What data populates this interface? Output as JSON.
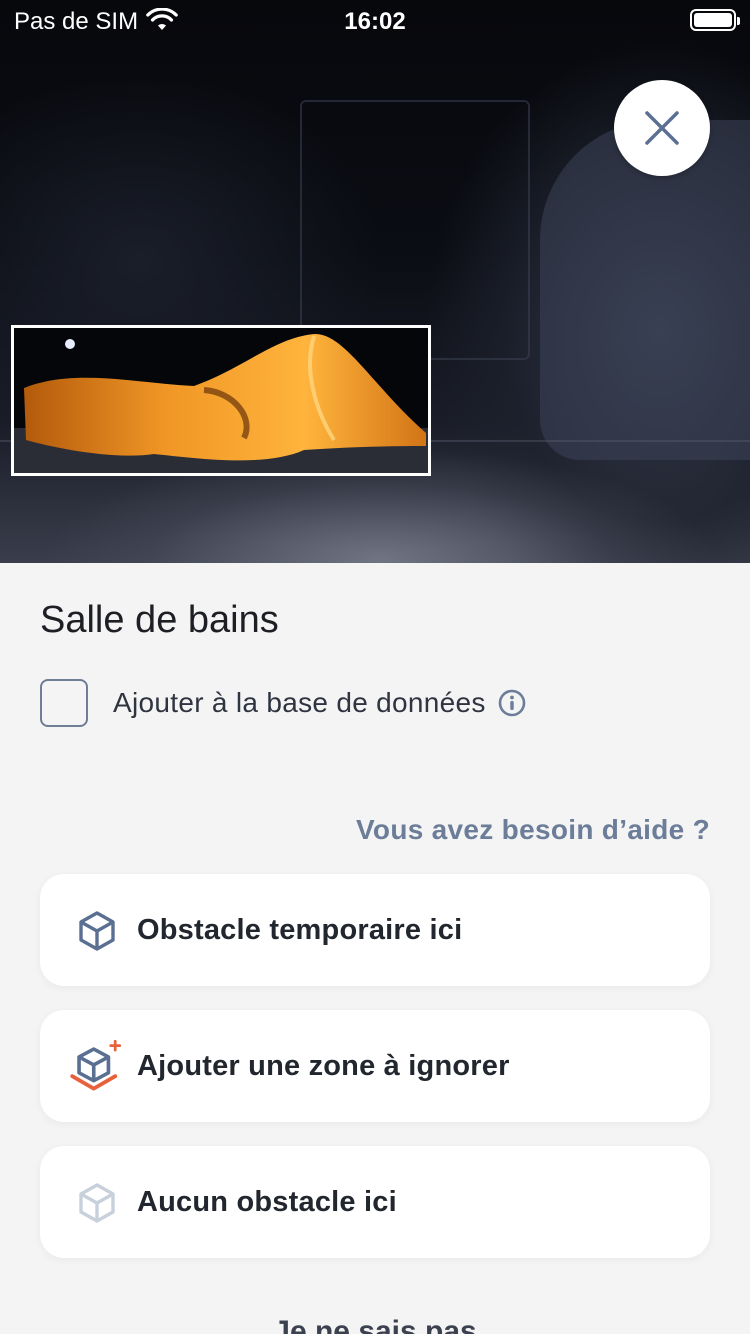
{
  "status_bar": {
    "carrier": "Pas de SIM",
    "time": "16:02"
  },
  "room": {
    "title": "Salle de bains"
  },
  "database": {
    "label": "Ajouter à la base de données",
    "checked": false
  },
  "help": {
    "label": "Vous avez besoin d’aide ?"
  },
  "options": [
    {
      "label": "Obstacle temporaire ici",
      "icon": "cube-icon"
    },
    {
      "label": "Ajouter une zone à ignorer",
      "icon": "add-zone-cube-icon"
    },
    {
      "label": "Aucun obstacle ici",
      "icon": "cube-outline-icon"
    }
  ],
  "footer": {
    "dont_know": "Je ne sais pas"
  },
  "colors": {
    "accent": "#6b7d98",
    "icon_blue": "#5a6f92",
    "zone_red": "#e8603c"
  }
}
